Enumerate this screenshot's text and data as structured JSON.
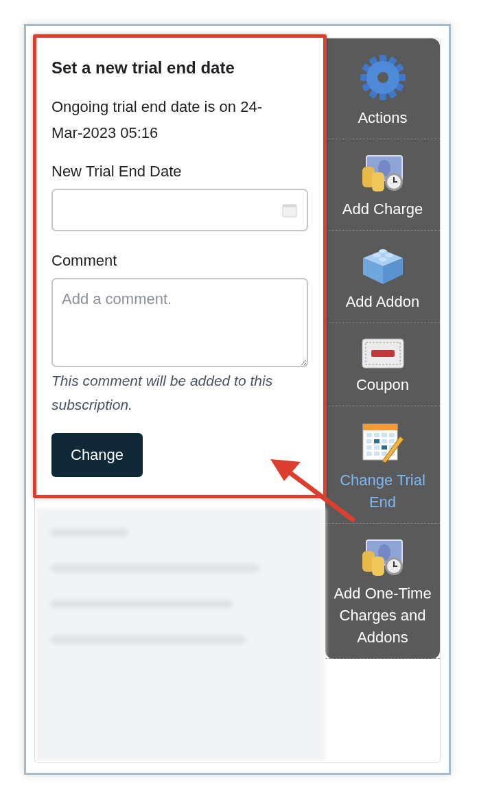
{
  "dialog": {
    "title": "Set a new trial end date",
    "info": "Ongoing trial end date is on 24-Mar-2023 05:16",
    "date_field": {
      "label": "New Trial End Date"
    },
    "comment_field": {
      "label": "Comment",
      "placeholder": "Add a comment."
    },
    "hint": "This comment will be added to this subscription.",
    "button": "Change"
  },
  "menu": [
    {
      "label": "Actions",
      "selected": false
    },
    {
      "label": "Add Charge",
      "selected": false
    },
    {
      "label": "Add Addon",
      "selected": false
    },
    {
      "label": "Coupon",
      "selected": false
    },
    {
      "label": "Change Trial End",
      "selected": true
    },
    {
      "label": "Add One-Time Charges and Addons",
      "selected": false
    }
  ]
}
